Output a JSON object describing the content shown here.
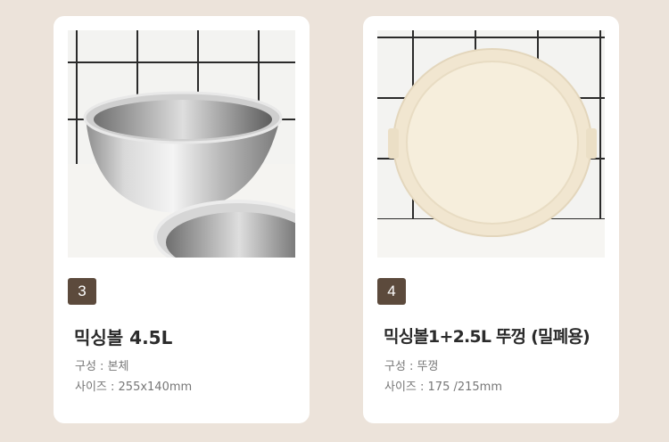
{
  "cards": [
    {
      "number": "3",
      "title": "믹싱볼 4.5L",
      "composition": "구성 : 본체",
      "size": "사이즈 : 255x140mm",
      "image": "stainless-mixing-bowls-photo"
    },
    {
      "number": "4",
      "title": "믹싱볼1+2.5L 뚜껑 (밀폐용)",
      "composition": "구성 : 뚜껑",
      "size": "사이즈 : 175 /215mm",
      "image": "cream-lid-photo"
    }
  ],
  "colors": {
    "background": "#ece3da",
    "card": "#ffffff",
    "badge": "#5c4a3c"
  }
}
